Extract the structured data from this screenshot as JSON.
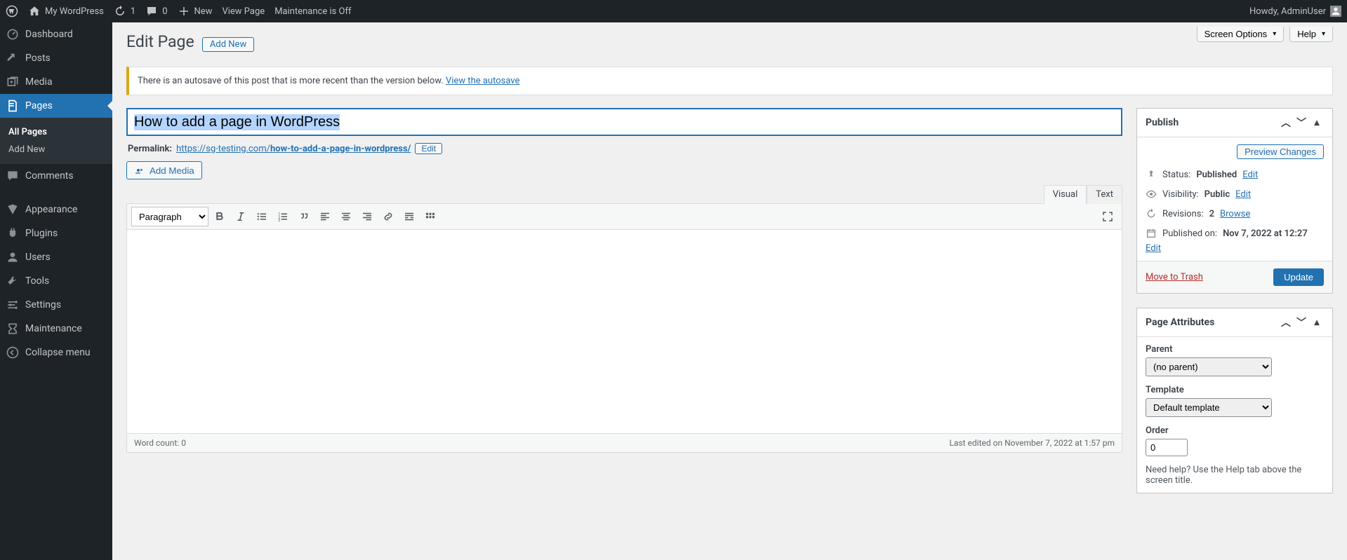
{
  "topbar": {
    "site": "My WordPress",
    "updates": "1",
    "comments": "0",
    "new": "New",
    "view": "View Page",
    "maint": "Maintenance is Off",
    "howdy": "Howdy, AdminUser"
  },
  "sidebar": {
    "items": [
      {
        "label": "Dashboard"
      },
      {
        "label": "Posts"
      },
      {
        "label": "Media"
      },
      {
        "label": "Pages"
      },
      {
        "label": "Comments"
      },
      {
        "label": "Appearance"
      },
      {
        "label": "Plugins"
      },
      {
        "label": "Users"
      },
      {
        "label": "Tools"
      },
      {
        "label": "Settings"
      },
      {
        "label": "Maintenance"
      },
      {
        "label": "Collapse menu"
      }
    ],
    "sub": {
      "all": "All Pages",
      "add": "Add New"
    }
  },
  "screen": {
    "options": "Screen Options",
    "help": "Help"
  },
  "heading": "Edit Page",
  "add_new": "Add New",
  "notice": {
    "text": "There is an autosave of this post that is more recent than the version below. ",
    "link": "View the autosave"
  },
  "title": "How to add a page in WordPress",
  "permalink": {
    "label": "Permalink:",
    "base": "https://sg-testing.com/",
    "slug": "how-to-add-a-page-in-wordpress/",
    "edit": "Edit"
  },
  "media": "Add Media",
  "editor": {
    "visual": "Visual",
    "text": "Text",
    "paragraph": "Paragraph",
    "wordcount_label": "Word count: ",
    "wordcount": "0",
    "lastedit": "Last edited on November 7, 2022 at 1:57 pm"
  },
  "publish": {
    "title": "Publish",
    "preview": "Preview Changes",
    "status_l": "Status:",
    "status_v": "Published",
    "edit": "Edit",
    "vis_l": "Visibility:",
    "vis_v": "Public",
    "rev_l": "Revisions:",
    "rev_v": "2",
    "browse": "Browse",
    "pub_l": "Published on:",
    "pub_v": "Nov 7, 2022 at 12:27",
    "trash": "Move to Trash",
    "update": "Update"
  },
  "attrs": {
    "title": "Page Attributes",
    "parent_l": "Parent",
    "parent_v": "(no parent)",
    "tpl_l": "Template",
    "tpl_v": "Default template",
    "order_l": "Order",
    "order_v": "0",
    "help": "Need help? Use the Help tab above the screen title."
  }
}
